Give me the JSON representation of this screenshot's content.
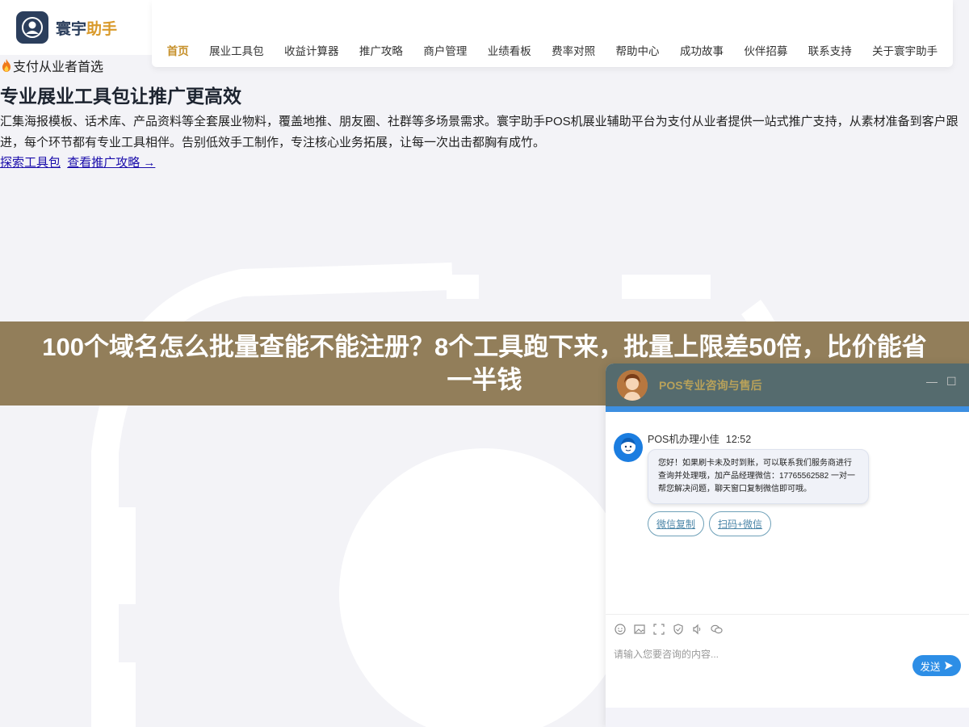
{
  "brand": {
    "name_main": "寰宇",
    "name_accent": "助手",
    "logo_icon": "user-profile-icon",
    "primary_color": "#2b3e5c",
    "accent_color": "#d99a2b"
  },
  "nav": {
    "items": [
      {
        "label": "首页",
        "active": true
      },
      {
        "label": "展业工具包",
        "active": false
      },
      {
        "label": "收益计算器",
        "active": false
      },
      {
        "label": "推广攻略",
        "active": false
      },
      {
        "label": "商户管理",
        "active": false
      },
      {
        "label": "业绩看板",
        "active": false
      },
      {
        "label": "费率对照",
        "active": false
      },
      {
        "label": "帮助中心",
        "active": false
      },
      {
        "label": "成功故事",
        "active": false
      },
      {
        "label": "伙伴招募",
        "active": false
      },
      {
        "label": "联系支持",
        "active": false
      },
      {
        "label": "关于寰宇助手",
        "active": false
      }
    ]
  },
  "hero": {
    "badge_icon": "fire-icon",
    "badge": "支付从业者首选",
    "title": "专业展业工具包让推广更高效",
    "description": "汇集海报模板、话术库、产品资料等全套展业物料，覆盖地推、朋友圈、社群等多场景需求。寰宇助手POS机展业辅助平台为支付从业者提供一站式推广支持，从素材准备到客户跟进，每个环节都有专业工具相伴。告别低效手工制作，专注核心业务拓展，让每一次出击都胸有成竹。",
    "link_primary": "探索工具包",
    "link_secondary": "查看推广攻略 →"
  },
  "banner": {
    "text": "100个域名怎么批量查能不能注册？8个工具跑下来，批量上限差50倍，比价能省一半钱"
  },
  "chat": {
    "title": "POS专业咨询与售后",
    "minimize_label": "—",
    "maximize_label": "☐",
    "agent_name": "POS机办理小佳",
    "time": "12:52",
    "message": "您好！如果刷卡未及时到账，可以联系我们服务商进行查询并处理哦，加产品经理微信：17765562582 一对一帮您解决问题，聊天窗口复制微信即可哦。",
    "quick_replies": [
      "微信复制",
      "扫码+微信"
    ],
    "toolbar_icons": [
      "emoji-icon",
      "image-icon",
      "screenshot-icon",
      "rating-icon",
      "voice-icon",
      "wechat-icon"
    ],
    "input_placeholder": "请输入您要咨询的内容...",
    "send_label": "发送",
    "header_color": "#556b6e",
    "send_color": "#2d8ee6"
  }
}
